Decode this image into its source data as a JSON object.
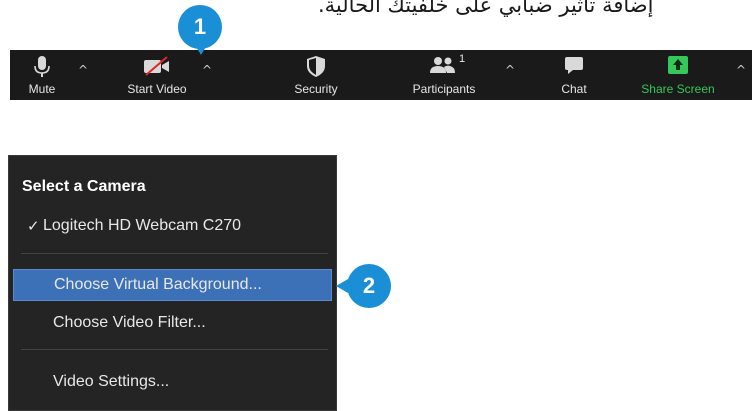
{
  "caption": {
    "arabic_text": "إضافة تأثير ضبابي على خلفيتك الحالية."
  },
  "toolbar": {
    "items": [
      {
        "label": "Mute",
        "icon": "microphone-icon"
      },
      {
        "label": "Start Video",
        "icon": "video-off-icon"
      },
      {
        "label": "Security",
        "icon": "shield-icon"
      },
      {
        "label": "Participants",
        "icon": "participants-icon",
        "count": "1"
      },
      {
        "label": "Chat",
        "icon": "chat-bubble-icon"
      },
      {
        "label": "Share Screen",
        "icon": "share-screen-icon"
      }
    ],
    "caret": "^",
    "share_color": "#34c759"
  },
  "callouts": {
    "step1": "1",
    "step2": "2",
    "color": "#1a8fd6"
  },
  "camera_menu": {
    "heading": "Select a Camera",
    "camera": "Logitech HD Webcam C270",
    "checkmark": "✓",
    "options": [
      "Choose Virtual Background...",
      "Choose Video Filter..."
    ],
    "settings": "Video Settings...",
    "highlight_color": "#3d71b7"
  }
}
